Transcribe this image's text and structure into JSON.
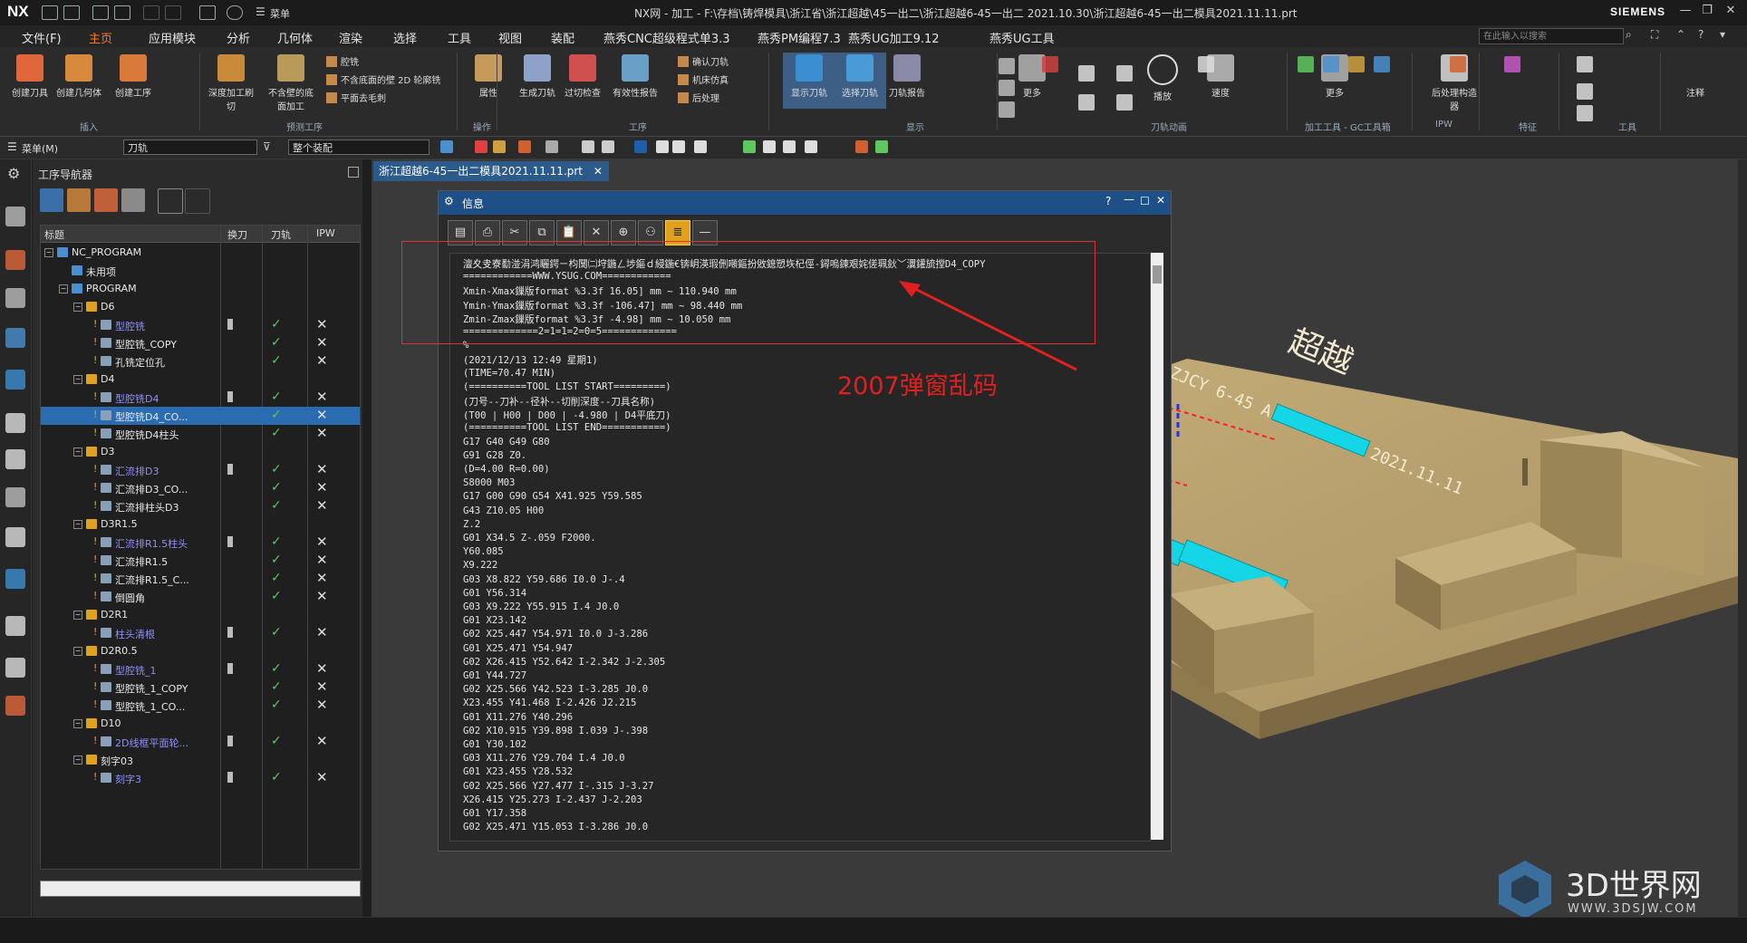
{
  "titlebar": {
    "logo": "NX",
    "title": "NX网 - 加工 - F:\\存档\\铸焊模具\\浙江省\\浙江超越\\45一出二\\浙江超越6-45一出二 2021.10.30\\浙江超越6-45一出二模具2021.11.11.prt",
    "brand": "SIEMENS",
    "menu_label": "菜单"
  },
  "menubar": {
    "tabs": [
      "文件(F)",
      "主页",
      "应用模块",
      "分析",
      "几何体",
      "渲染",
      "选择",
      "工具",
      "视图",
      "装配",
      "燕秀CNC超级程式单3.3",
      "燕秀PM编程7.3",
      "燕秀UG加工9.12",
      "燕秀UG工具"
    ],
    "active_tab": "主页",
    "search_placeholder": "在此输入以搜索"
  },
  "ribbon": {
    "buttons": [
      "创建刀具",
      "创建几何体",
      "创建工序",
      "深度加工刷切",
      "不含壁的底面加工",
      "属性",
      "生成刀轨",
      "过切检查",
      "有效性报告",
      "显示刀轨",
      "选择刀轨",
      "刀轨报告",
      "更多",
      "播放",
      "速度",
      "更多",
      "后处理构造器",
      "注释"
    ],
    "small_items": [
      "腔铣",
      "不含底面的壁 2D 轮廓铣",
      "平面去毛刺",
      "确认刀轨",
      "机床仿真",
      "后处理"
    ],
    "groups": [
      "插入",
      "预测工序",
      "操作",
      "工序",
      "显示",
      "刀轨动画",
      "加工工具 - GC工具箱",
      "IPW",
      "特征",
      "工具"
    ]
  },
  "toolbar2": {
    "menu": "菜单(M)",
    "filter": "刀轨",
    "assembly": "整个装配"
  },
  "navigator": {
    "title": "工序导航器",
    "columns": [
      "标题",
      "换刀",
      "刀轨",
      "IPW"
    ],
    "rows": [
      {
        "name": "NC_PROGRAM",
        "level": 0,
        "type": "root"
      },
      {
        "name": "未用项",
        "level": 1,
        "type": "folder"
      },
      {
        "name": "PROGRAM",
        "level": 1,
        "type": "folder"
      },
      {
        "name": "D6",
        "level": 2,
        "type": "group"
      },
      {
        "name": "型腔铣",
        "level": 3,
        "type": "op",
        "blue": true,
        "pen": true,
        "check": true,
        "x": true
      },
      {
        "name": "型腔铣_COPY",
        "level": 3,
        "type": "op",
        "check": true,
        "x": true
      },
      {
        "name": "孔铣定位孔",
        "level": 3,
        "type": "op",
        "check": true,
        "x": true
      },
      {
        "name": "D4",
        "level": 2,
        "type": "group"
      },
      {
        "name": "型腔铣D4",
        "level": 3,
        "type": "op",
        "blue": true,
        "pen": true,
        "check": true,
        "x": true
      },
      {
        "name": "型腔铣D4_CO...",
        "level": 3,
        "type": "op",
        "selected": true,
        "check": true,
        "x": true
      },
      {
        "name": "型腔铣D4柱头",
        "level": 3,
        "type": "op",
        "check": true,
        "x": true
      },
      {
        "name": "D3",
        "level": 2,
        "type": "group"
      },
      {
        "name": "汇流排D3",
        "level": 3,
        "type": "op",
        "blue": true,
        "pen": true,
        "check": true,
        "x": true
      },
      {
        "name": "汇流排D3_CO...",
        "level": 3,
        "type": "op",
        "check": true,
        "x": true
      },
      {
        "name": "汇流排柱头D3",
        "level": 3,
        "type": "op",
        "check": true,
        "x": true
      },
      {
        "name": "D3R1.5",
        "level": 2,
        "type": "group"
      },
      {
        "name": "汇流排R1.5柱头",
        "level": 3,
        "type": "op",
        "blue": true,
        "pen": true,
        "check": true,
        "x": true
      },
      {
        "name": "汇流排R1.5",
        "level": 3,
        "type": "op",
        "check": true,
        "x": true
      },
      {
        "name": "汇流排R1.5_C...",
        "level": 3,
        "type": "op",
        "check": true,
        "x": true
      },
      {
        "name": "倒圆角",
        "level": 3,
        "type": "op",
        "check": true,
        "x": true
      },
      {
        "name": "D2R1",
        "level": 2,
        "type": "group"
      },
      {
        "name": "柱头清根",
        "level": 3,
        "type": "op",
        "blue": true,
        "pen": true,
        "check": true,
        "x": true
      },
      {
        "name": "D2R0.5",
        "level": 2,
        "type": "group"
      },
      {
        "name": "型腔铣_1",
        "level": 3,
        "type": "op",
        "blue": true,
        "pen": true,
        "check": true,
        "x": true
      },
      {
        "name": "型腔铣_1_COPY",
        "level": 3,
        "type": "op",
        "check": true,
        "x": true
      },
      {
        "name": "型腔铣_1_CO...",
        "level": 3,
        "type": "op",
        "check": true,
        "x": true
      },
      {
        "name": "D10",
        "level": 2,
        "type": "group"
      },
      {
        "name": "2D线框平面轮...",
        "level": 3,
        "type": "op",
        "blue": true,
        "pen": true,
        "check": true,
        "x": true
      },
      {
        "name": "刻字03",
        "level": 2,
        "type": "group"
      },
      {
        "name": "刻字3",
        "level": 3,
        "type": "op",
        "blue": true,
        "pen": true,
        "check": true,
        "x": true
      }
    ]
  },
  "document_tab": "浙江超越6-45一出二模具2021.11.11.prt",
  "info_dialog": {
    "title": "信息",
    "lines": [
      "澶夊叏寮勫湴涓鸿矖鍔ㄧ枃闅㈡垨鍦ㄥ埗鏂ｄ綅鍦€锛岄渶瑕侀噸鏂扮敓鎴愬垁杞俓-鐞嗚鍊艰姹傞珮鈥﹀瀷鑵旈摚D4_COPY",
      "============WWW.YSUG.COM============",
      "Xmin-Xmax鏁版format %3.3f 16.05] mm ~ 110.940 mm",
      "Ymin-Ymax鏁版format %3.3f -106.47] mm ~ 98.440 mm",
      "Zmin-Zmax鏁版format %3.3f -4.98] mm ~ 10.050 mm",
      "=============2=1=1=2=0=5=============",
      "%",
      "(2021/12/13 12:49 星期1)",
      "(TIME=70.47 MIN)",
      "(==========TOOL LIST START=========)",
      "(刀号--刀补--径补--切削深度--刀具名称)",
      "(T00 | H00 | D00 | -4.980 | D4平底刀)",
      "(==========TOOL LIST END===========)",
      "G17 G40 G49 G80",
      "G91 G28 Z0.",
      "(D=4.00 R=0.00)",
      "S8000 M03",
      "G17 G00 G90 G54 X41.925 Y59.585",
      "G43 Z10.05 H00",
      "Z.2",
      "G01 X34.5 Z-.059 F2000.",
      "Y60.085",
      "X9.222",
      "G03 X8.822 Y59.686 I0.0 J-.4",
      "G01 Y56.314",
      "G03 X9.222 Y55.915 I.4 J0.0",
      "G01 X23.142",
      "G02 X25.447 Y54.971 I0.0 J-3.286",
      "G01 X25.471 Y54.947",
      "G02 X26.415 Y52.642 I-2.342 J-2.305",
      "G01 Y44.727",
      "G02 X25.566 Y42.523 I-3.285 J0.0",
      "X23.455 Y41.468 I-2.426 J2.215",
      "G01 X11.276 Y40.296",
      "G02 X10.915 Y39.898 I.039 J-.398",
      "G01 Y30.102",
      "G03 X11.276 Y29.704 I.4 J0.0",
      "G01 X23.455 Y28.532",
      "G02 X25.566 Y27.477 I-.315 J-3.27",
      "X26.415 Y25.273 I-2.437 J-2.203",
      "G01 Y17.358",
      "G02 X25.471 Y15.053 I-3.286 J0.0"
    ]
  },
  "annotation": "2007弹窗乱码",
  "model_engraving": [
    "ZJCY 6-45 A-00 - 01 - 2021.11.11",
    "超越"
  ],
  "watermark": {
    "name": "3D世界网",
    "url": "WWW.3DSJW.COM"
  },
  "colors": {
    "accent": "#ff7a2f",
    "selection": "#2b6cb0",
    "model": "#b9a26b",
    "toolpath": "#00d8e8",
    "annotation": "#e02020"
  }
}
